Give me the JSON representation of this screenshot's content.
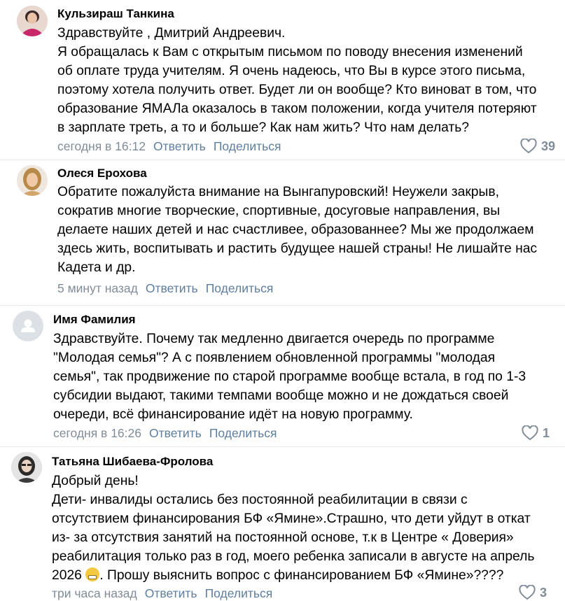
{
  "comments": [
    {
      "author": "Кульзираш Танкина",
      "lines": [
        "Здравствуйте , Дмитрий Андреевич.",
        "Я обращалась к Вам с открытым письмом по поводу внесения изменений",
        "об оплате труда учителям. Я очень надеюсь, что Вы в курсе этого письма,",
        "поэтому хотела получить ответ. Будет ли он вообще? Кто виноват в том, что",
        "образование ЯМАЛа оказалось в таком положении, когда учителя потеряют",
        "в зарплате треть, а то и больше? Как нам жить? Что нам делать?"
      ],
      "time": "сегодня в 16:12",
      "reply": "Ответить",
      "share": "Поделиться",
      "likes": "39"
    },
    {
      "author": "Олеся Ерохова",
      "lines": [
        "Обратите пожалуйста внимание на Вынгапуровский! Неужели закрыв,",
        "сократив многие творческие, спортивные, досуговые направления, вы",
        "делаете наших детей и нас счастливее, образованнее? Мы же продолжаем",
        "здесь жить, воспитывать и растить будущее нашей страны! Не лишайте нас",
        "Кадета и др."
      ],
      "time": "5 минут назад",
      "reply": "Ответить",
      "share": "Поделиться",
      "likes": ""
    },
    {
      "author": "Имя Фамилия",
      "lines": [
        "Здравствуйте. Почему так медленно двигается очередь по программе",
        "\"Молодая семья\"? А с появлением обновленной программы \"молодая",
        "семья\", так продвижение по старой программе вообще встала, в год по 1-3",
        "субсидии выдают, такими темпами вообще можно и не дождаться своей",
        "очереди, всё финансирование идёт на новую программу."
      ],
      "time": "сегодня в 16:26",
      "reply": "Ответить",
      "share": "Поделиться",
      "likes": "1"
    },
    {
      "author": "Татьяна Шибаева-Фролова",
      "lines": [
        "Добрый день!",
        "Дети- инвалиды остались без постоянной реабилитации в связи с",
        "отсутствием финансирования БФ «Ямине».Страшно, что дети уйдут в откат",
        "из- за отсутствия занятий на постоянной основе, т.к в Центре « Доверия»",
        "реабилитация только раз в год, моего ребенка записали в августе на апрель"
      ],
      "last_line_before": "2026",
      "last_line_emoji": "grimacing-face-emoji",
      "last_line_after": ". Прошу выяснить вопрос с финансированием БФ «Ямине»????",
      "time": "три часа назад",
      "reply": "Ответить",
      "share": "Поделиться",
      "likes": "3"
    }
  ],
  "icons": {
    "like": "heart-outline-icon",
    "placeholder_avatar": "user-silhouette-icon"
  },
  "colors": {
    "meta": "#818c99",
    "action": "#5d7e9e",
    "divider": "#e7e8ec"
  }
}
